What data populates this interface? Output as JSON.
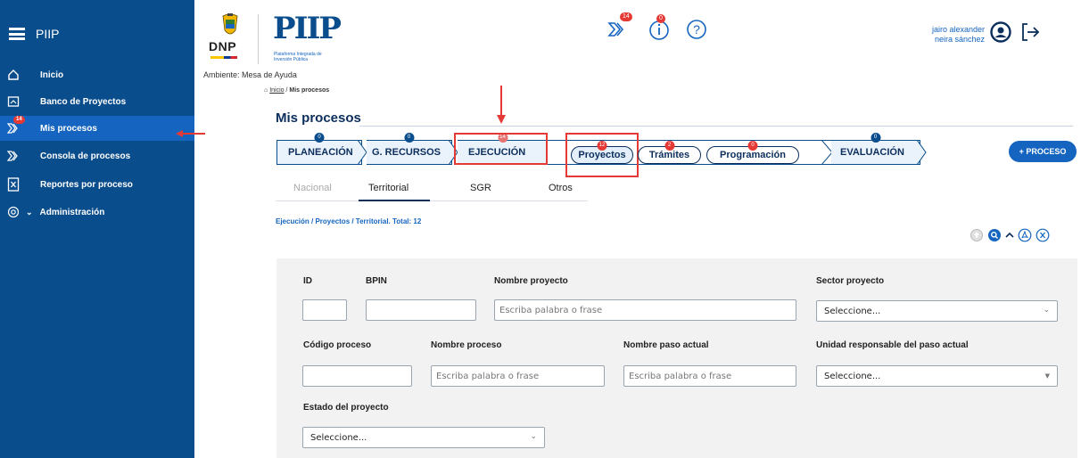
{
  "sidebar": {
    "title": "PIIP",
    "items": [
      {
        "label": "Inicio",
        "icon": "home-icon"
      },
      {
        "label": "Banco de Proyectos",
        "icon": "folder-icon"
      },
      {
        "label": "Mis procesos",
        "icon": "process-arrows-icon",
        "badge": "14",
        "active": true
      },
      {
        "label": "Consola de procesos",
        "icon": "console-arrows-icon"
      },
      {
        "label": "Reportes por proceso",
        "icon": "excel-report-icon"
      },
      {
        "label": "Administración",
        "icon": "admin-gear-icon",
        "chevron": "⌄"
      }
    ]
  },
  "header": {
    "dnp_logo_text": "DNP",
    "piip_logo_text": "PIIP",
    "piip_subtitle": "Plataforma Integrada de Inversión Pública",
    "ambiente": "Ambiente: Mesa de Ayuda",
    "process_badge": "14",
    "info_badge": "0",
    "user_name_line1": "jairo alexander",
    "user_name_line2": "neira sánchez"
  },
  "breadcrumb": {
    "home": "Inicio",
    "separator": "/",
    "current": "Mis procesos"
  },
  "page_title": "Mis procesos",
  "phases": [
    {
      "label": "PLANEACIÓN",
      "badge": "0"
    },
    {
      "label": "G. RECURSOS",
      "badge": "0"
    },
    {
      "label": "EJECUCIÓN",
      "badge": "14"
    },
    {
      "label": "EVALUACIÓN",
      "badge": "0"
    }
  ],
  "subphases": [
    {
      "label": "Proyectos",
      "badge": "12",
      "selected": true
    },
    {
      "label": "Trámites",
      "badge": "2"
    },
    {
      "label": "Programación",
      "badge": "0"
    }
  ],
  "new_process_button": "+ PROCESO",
  "tabs": [
    {
      "label": "Nacional",
      "disabled": true
    },
    {
      "label": "Territorial",
      "active": true
    },
    {
      "label": "SGR"
    },
    {
      "label": "Otros"
    }
  ],
  "summary": "Ejecución / Proyectos / Territorial. Total: 12",
  "filters": {
    "id_label": "ID",
    "bpin_label": "BPIN",
    "nombre_proyecto_label": "Nombre proyecto",
    "nombre_proyecto_placeholder": "Escriba palabra o frase",
    "sector_label": "Sector proyecto",
    "sector_value": "Seleccione...",
    "codigo_proceso_label": "Código proceso",
    "nombre_proceso_label": "Nombre proceso",
    "nombre_proceso_placeholder": "Escriba palabra o frase",
    "nombre_paso_label": "Nombre paso actual",
    "nombre_paso_placeholder": "Escriba palabra o frase",
    "unidad_label": "Unidad responsable del paso actual",
    "unidad_value": "Seleccione...",
    "estado_label": "Estado del proyecto",
    "estado_value": "Seleccione..."
  },
  "colors": {
    "sidebar_bg": "#0a4d8c",
    "sidebar_active": "#1565c0",
    "annotation_red": "#e53935",
    "title_navy": "#0b2e5c",
    "link_blue": "#1565c0"
  }
}
